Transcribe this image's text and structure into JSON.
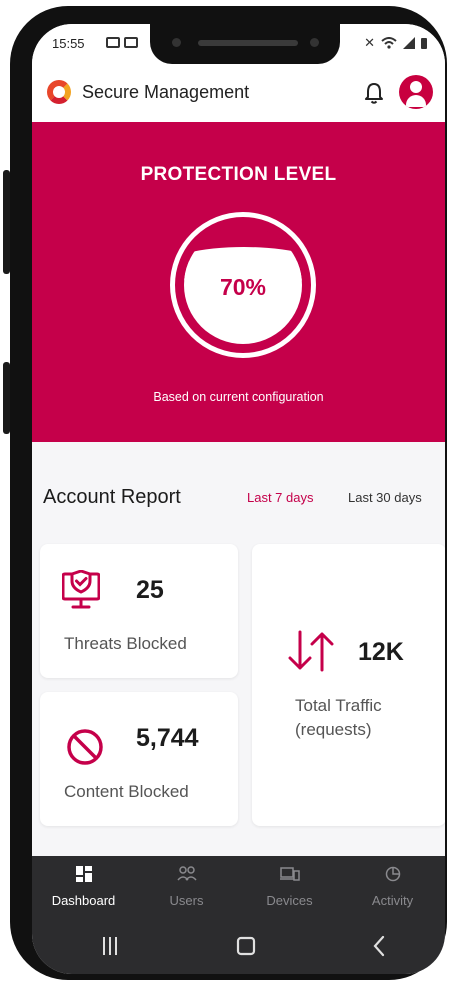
{
  "status_bar": {
    "time": "15:55"
  },
  "header": {
    "app_title": "Secure Management"
  },
  "protection": {
    "title": "PROTECTION LEVEL",
    "level_text": "70%",
    "level_fraction": 0.7,
    "caption": "Based on current configuration"
  },
  "report": {
    "title": "Account Report",
    "ranges": [
      "Last 7 days",
      "Last 30 days"
    ],
    "selected_range": "Last 7 days",
    "threats": {
      "value": "25",
      "label": "Threats Blocked"
    },
    "content": {
      "value": "5,744",
      "label": "Content Blocked"
    },
    "traffic": {
      "value": "12K",
      "label_line1": "Total Traffic",
      "label_line2": "(requests)"
    }
  },
  "bottom_nav": {
    "items": [
      {
        "label": "Dashboard",
        "icon": "dashboard-icon",
        "active": true
      },
      {
        "label": "Users",
        "icon": "users-icon",
        "active": false
      },
      {
        "label": "Devices",
        "icon": "devices-icon",
        "active": false
      },
      {
        "label": "Activity",
        "icon": "activity-icon",
        "active": false
      }
    ]
  },
  "colors": {
    "accent": "#c5004a",
    "nav_background": "#2c2c2e",
    "page_background": "#f6f6f8"
  }
}
